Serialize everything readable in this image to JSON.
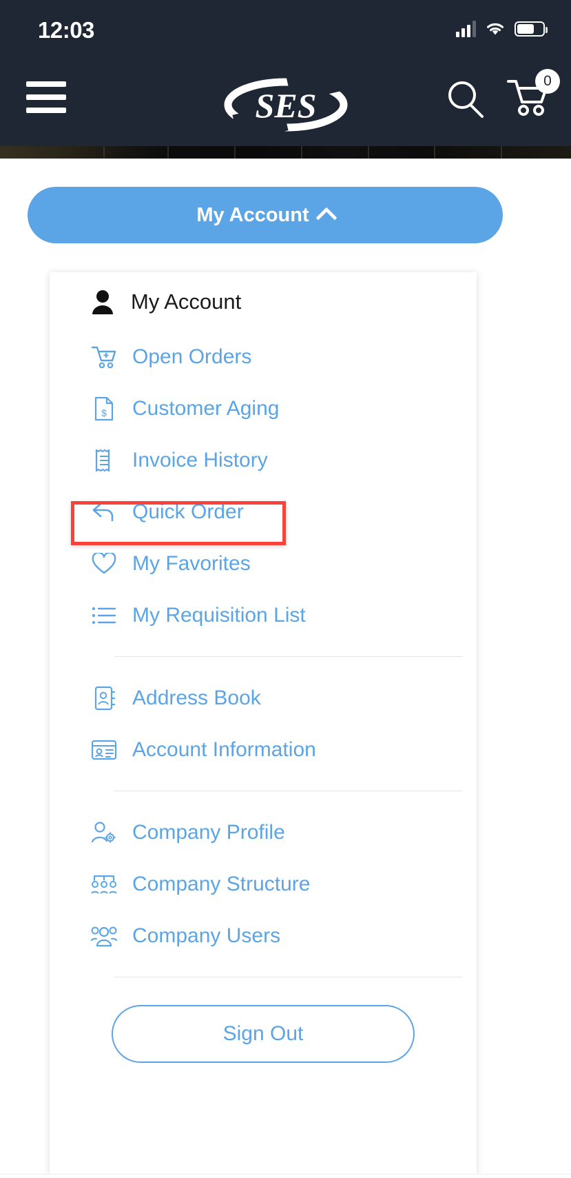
{
  "status_bar": {
    "time": "12:03",
    "signal_icon": "cellular-signal-icon",
    "wifi_icon": "wifi-icon",
    "battery_icon": "battery-icon"
  },
  "header": {
    "menu_icon": "hamburger-menu-icon",
    "logo_text": "SES",
    "search_icon": "search-icon",
    "cart_icon": "shopping-cart-icon",
    "cart_count": "0",
    "background_color": "#1e2733"
  },
  "account_button": {
    "label": "My Account",
    "chevron_icon": "chevron-up-icon",
    "color": "#5ba4e6"
  },
  "menu": {
    "heading": "My Account",
    "heading_icon": "person-filled-icon",
    "link_color": "#5ba4e6",
    "groups": [
      {
        "items": [
          {
            "label": "Open Orders",
            "icon": "cart-plus-icon",
            "highlighted": true
          },
          {
            "label": "Customer Aging",
            "icon": "document-dollar-icon"
          },
          {
            "label": "Invoice History",
            "icon": "receipt-icon"
          },
          {
            "label": "Quick Order",
            "icon": "reply-arrow-icon"
          },
          {
            "label": "My Favorites",
            "icon": "heart-icon"
          },
          {
            "label": "My Requisition List",
            "icon": "bullet-list-icon"
          }
        ]
      },
      {
        "items": [
          {
            "label": "Address Book",
            "icon": "address-book-icon"
          },
          {
            "label": "Account Information",
            "icon": "id-card-icon"
          }
        ]
      },
      {
        "items": [
          {
            "label": "Company Profile",
            "icon": "person-gear-icon"
          },
          {
            "label": "Company Structure",
            "icon": "org-chart-icon"
          },
          {
            "label": "Company Users",
            "icon": "people-group-icon"
          }
        ]
      }
    ],
    "sign_out_label": "Sign Out"
  },
  "annotation": {
    "target": "Open Orders",
    "color": "#f9423a"
  }
}
